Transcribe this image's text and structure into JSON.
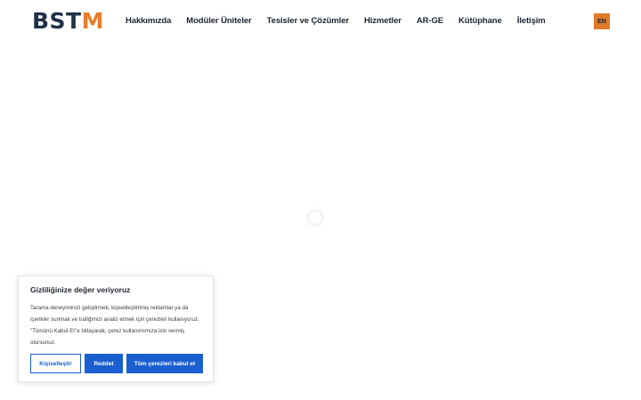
{
  "logo": {
    "part1": "BST",
    "part2": "M"
  },
  "nav": {
    "items": [
      "Hakkımızda",
      "Modüler Üniteler",
      "Tesisler ve Çözümler",
      "Hizmetler",
      "AR-GE",
      "Kütüphane",
      "İletişim"
    ]
  },
  "language": {
    "label": "EN"
  },
  "cookie": {
    "title": "Gizliliğinize değer veriyoruz",
    "text": "Tarama deneyiminizi geliştirmek, kişiselleştirilmiş reklamlar ya da içerikler sunmak ve trafiğimizi analiz etmek için çerezleri kullanıyoruz. \"Tümünü Kabul Et\"e tıklayarak, çerez kullanımımıza izin vermiş olursunuz.",
    "customize_label": "Kişiselleştir",
    "reject_label": "Reddet",
    "accept_label": "Tüm çerezleri kabul et"
  },
  "colors": {
    "brand_dark": "#203247",
    "brand_accent": "#e87d2a",
    "button_blue": "#1a5fd0"
  }
}
